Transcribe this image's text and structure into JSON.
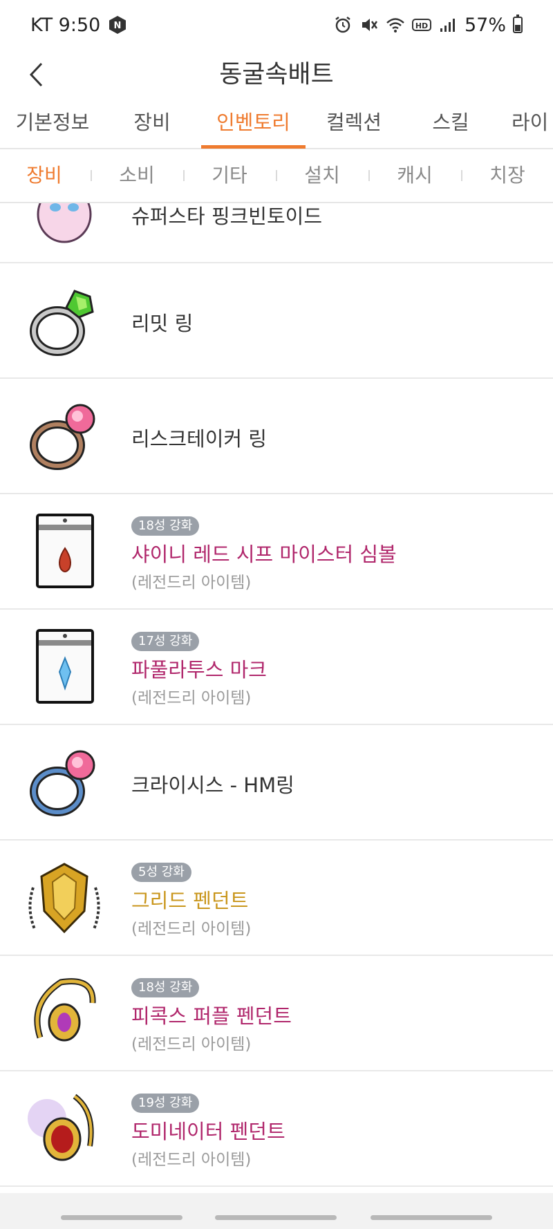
{
  "status": {
    "carrier_time": "KT 9:50",
    "battery": "57%"
  },
  "header": {
    "title": "동굴속배트"
  },
  "tabs": [
    {
      "label": "기본정보"
    },
    {
      "label": "장비"
    },
    {
      "label": "인벤토리"
    },
    {
      "label": "컬렉션"
    },
    {
      "label": "스킬"
    },
    {
      "label": "라이"
    }
  ],
  "subtabs": [
    {
      "label": "장비"
    },
    {
      "label": "소비"
    },
    {
      "label": "기타"
    },
    {
      "label": "설치"
    },
    {
      "label": "캐시"
    },
    {
      "label": "치장"
    }
  ],
  "items": [
    {
      "name": "슈퍼스타 핑크빈토이드",
      "badge": "",
      "grade": "",
      "name_color": "#333333"
    },
    {
      "name": "리밋 링",
      "badge": "",
      "grade": "",
      "name_color": "#333333"
    },
    {
      "name": "리스크테이커 링",
      "badge": "",
      "grade": "",
      "name_color": "#333333"
    },
    {
      "name": "샤이니 레드 시프 마이스터 심볼",
      "badge": "18성 강화",
      "grade": "(레전드리 아이템)",
      "name_color": "#b0266b"
    },
    {
      "name": "파풀라투스 마크",
      "badge": "17성 강화",
      "grade": "(레전드리 아이템)",
      "name_color": "#b0266b"
    },
    {
      "name": "크라이시스 - HM링",
      "badge": "",
      "grade": "",
      "name_color": "#333333"
    },
    {
      "name": "그리드 펜던트",
      "badge": "5성 강화",
      "grade": "(레전드리 아이템)",
      "name_color": "#c9961c"
    },
    {
      "name": "피콕스 퍼플 펜던트",
      "badge": "18성 강화",
      "grade": "(레전드리 아이템)",
      "name_color": "#b0266b"
    },
    {
      "name": "도미네이터 펜던트",
      "badge": "19성 강화",
      "grade": "(레전드리 아이템)",
      "name_color": "#b0266b"
    }
  ],
  "icons": {
    "items": [
      "pink-bean-icon",
      "limit-ring-icon",
      "risk-taker-ring-icon",
      "symbol-icon",
      "mark-icon",
      "crisis-ring-icon",
      "greed-pendant-icon",
      "peacock-pendant-icon",
      "dominator-pendant-icon"
    ]
  }
}
